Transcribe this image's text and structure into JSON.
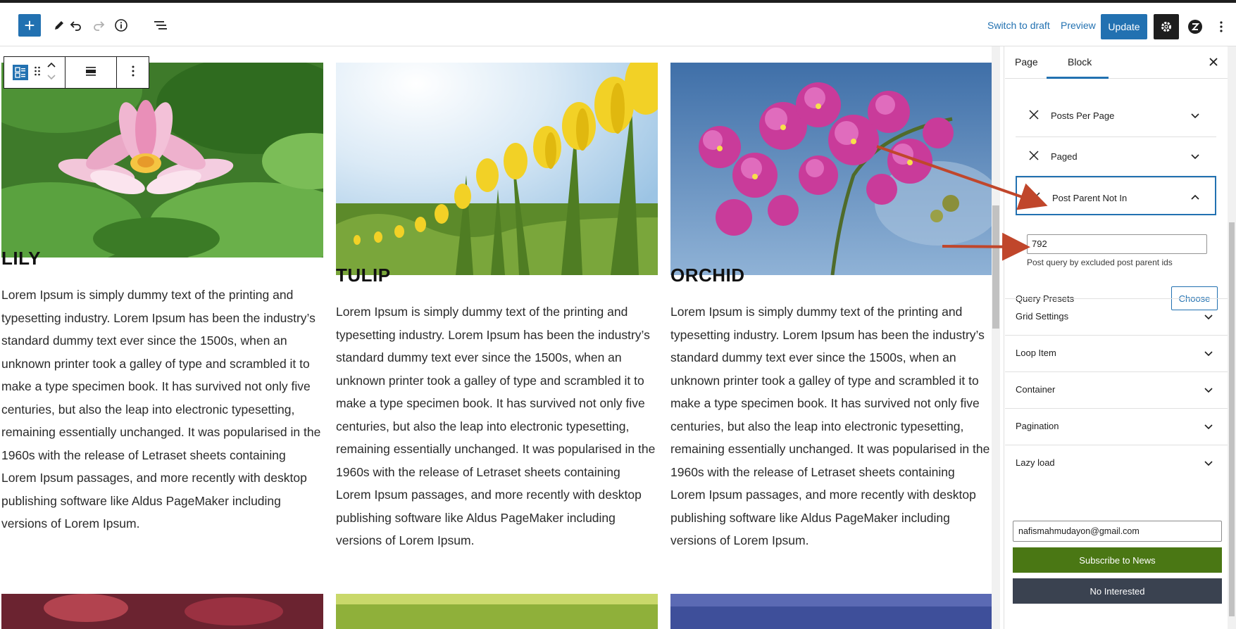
{
  "toolbar": {
    "switch_to_draft": "Switch to draft",
    "preview": "Preview",
    "update": "Update"
  },
  "columns": [
    {
      "title": "LILY",
      "image": "pink water lily on green lily pads",
      "text": "Lorem Ipsum is simply dummy text of the printing and typesetting industry. Lorem Ipsum has been the industry’s standard dummy text ever since the 1500s, when an unknown printer took a galley of type and scrambled it to make a type specimen book. It has survived not only five centuries, but also the leap into electronic typesetting, remaining essentially unchanged. It was popularised in the 1960s with the release of Letraset sheets containing Lorem Ipsum passages, and more recently with desktop publishing software like Aldus PageMaker including versions of Lorem Ipsum."
    },
    {
      "title": "TULIP",
      "image": "yellow tulips against a bright sky",
      "text": "Lorem Ipsum is simply dummy text of the printing and typesetting industry. Lorem Ipsum has been the industry’s standard dummy text ever since the 1500s, when an unknown printer took a galley of type and scrambled it to make a type specimen book. It has survived not only five centuries, but also the leap into electronic typesetting, remaining essentially unchanged. It was popularised in the 1960s with the release of Letraset sheets containing Lorem Ipsum passages, and more recently with desktop publishing software like Aldus PageMaker including versions of Lorem Ipsum."
    },
    {
      "title": "ORCHID",
      "image": "magenta orchids against a blue sky",
      "text": "Lorem Ipsum is simply dummy text of the printing and typesetting industry. Lorem Ipsum has been the industry’s standard dummy text ever since the 1500s, when an unknown printer took a galley of type and scrambled it to make a type specimen book. It has survived not only five centuries, but also the leap into electronic typesetting, remaining essentially unchanged. It was popularised in the 1960s with the release of Letraset sheets containing Lorem Ipsum passages, and more recently with desktop publishing software like Aldus PageMaker including versions of Lorem Ipsum."
    }
  ],
  "sidebar": {
    "tabs": [
      "Page",
      "Block"
    ],
    "active_tab": "Block",
    "query_params": [
      {
        "label": "Posts Per Page"
      },
      {
        "label": "Paged"
      },
      {
        "label": "Post Parent Not In"
      }
    ],
    "param_value": "792",
    "param_help": "Post query by excluded post parent ids",
    "presets_label": "Query Presets",
    "choose_label": "Choose",
    "panels": [
      "Grid Settings",
      "Loop Item",
      "Container",
      "Pagination",
      "Lazy load"
    ],
    "email_value": "nafismahmudayon@gmail.com",
    "subscribe_label": "Subscribe to News",
    "no_interest_label": "No Interested"
  },
  "colors": {
    "accent": "#2271b1",
    "annotation_arrow": "#c0462b",
    "subscribe": "#4a7714",
    "no_interest": "#3a4250"
  }
}
